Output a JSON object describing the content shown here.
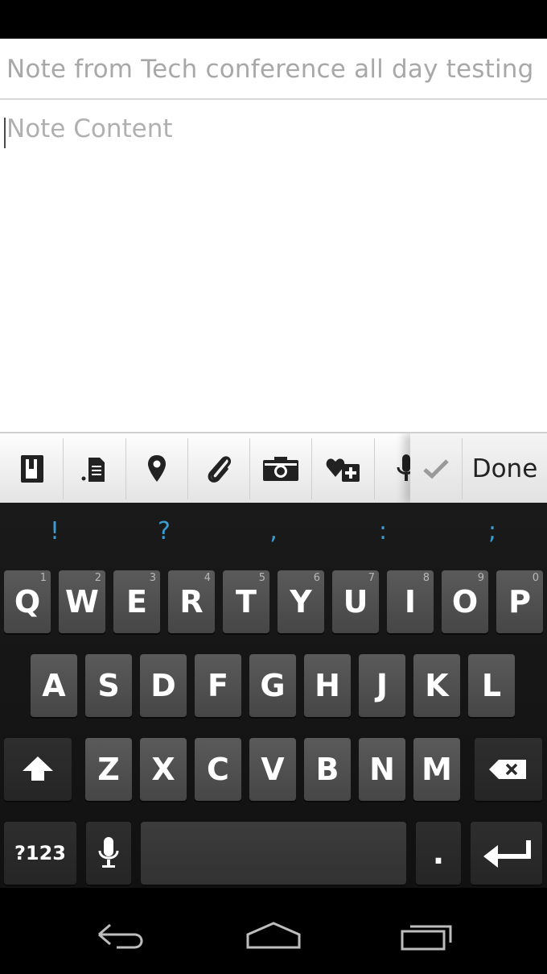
{
  "note": {
    "title_value": "Note from Tech conference all day testing",
    "content_placeholder": "Note Content"
  },
  "toolbar": {
    "icons": [
      "notebook-icon",
      "tag-icon",
      "location-pin-icon",
      "paperclip-icon",
      "camera-icon",
      "add-favorite-icon",
      "microphone-icon"
    ],
    "check_icon": "checkmark-icon",
    "done_label": "Done"
  },
  "keyboard": {
    "suggestions": [
      "!",
      "?",
      ",",
      ":",
      ";"
    ],
    "row1": [
      {
        "label": "Q",
        "hint": "1"
      },
      {
        "label": "W",
        "hint": "2"
      },
      {
        "label": "E",
        "hint": "3"
      },
      {
        "label": "R",
        "hint": "4"
      },
      {
        "label": "T",
        "hint": "5"
      },
      {
        "label": "Y",
        "hint": "6"
      },
      {
        "label": "U",
        "hint": "7"
      },
      {
        "label": "I",
        "hint": "8"
      },
      {
        "label": "O",
        "hint": "9"
      },
      {
        "label": "P",
        "hint": "0"
      }
    ],
    "row2": [
      "A",
      "S",
      "D",
      "F",
      "G",
      "H",
      "J",
      "K",
      "L"
    ],
    "row3": [
      "Z",
      "X",
      "C",
      "V",
      "B",
      "N",
      "M"
    ],
    "symbols_label": "?123",
    "period_label": ".",
    "accent_color": "#3a9cd0"
  },
  "nav": {
    "buttons": [
      "back-icon",
      "home-icon",
      "recent-apps-icon"
    ]
  }
}
